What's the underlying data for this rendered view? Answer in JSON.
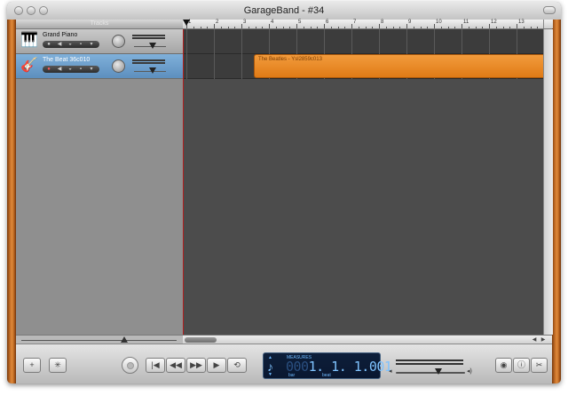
{
  "window": {
    "title": "GarageBand - #34"
  },
  "tracks_header": {
    "label": "Tracks"
  },
  "tracks": [
    {
      "name": "Grand Piano",
      "icon": "piano-icon",
      "selected": false
    },
    {
      "name": "The Beat  36c010",
      "icon": "guitar-icon",
      "selected": true
    }
  ],
  "ruler": {
    "marks": [
      "1",
      "2",
      "3",
      "4",
      "5",
      "6",
      "7",
      "8",
      "9",
      "10",
      "11",
      "12",
      "13"
    ]
  },
  "region": {
    "label": "The Beatles - Ysl2859c013",
    "color": "#e88a24"
  },
  "lcd": {
    "mode": "MEASURES",
    "time_dim": "000",
    "time": "1. 1. 1.001",
    "bar_label": "bar",
    "beat_label": "beat"
  },
  "controls": {
    "add_track": "+",
    "loop_browser": "✳",
    "rewind_start": "|◀",
    "rewind": "◀◀",
    "fast_forward": "▶▶",
    "play": "▶",
    "cycle": "⟲",
    "media_eye": "◉",
    "info": "ⓘ",
    "editor": "✂"
  },
  "colors": {
    "accent_blue": "#6f9ecb",
    "wood": "#c9722a",
    "lcd_bg": "#0d1f3a",
    "lcd_text": "#7fc3ff"
  }
}
